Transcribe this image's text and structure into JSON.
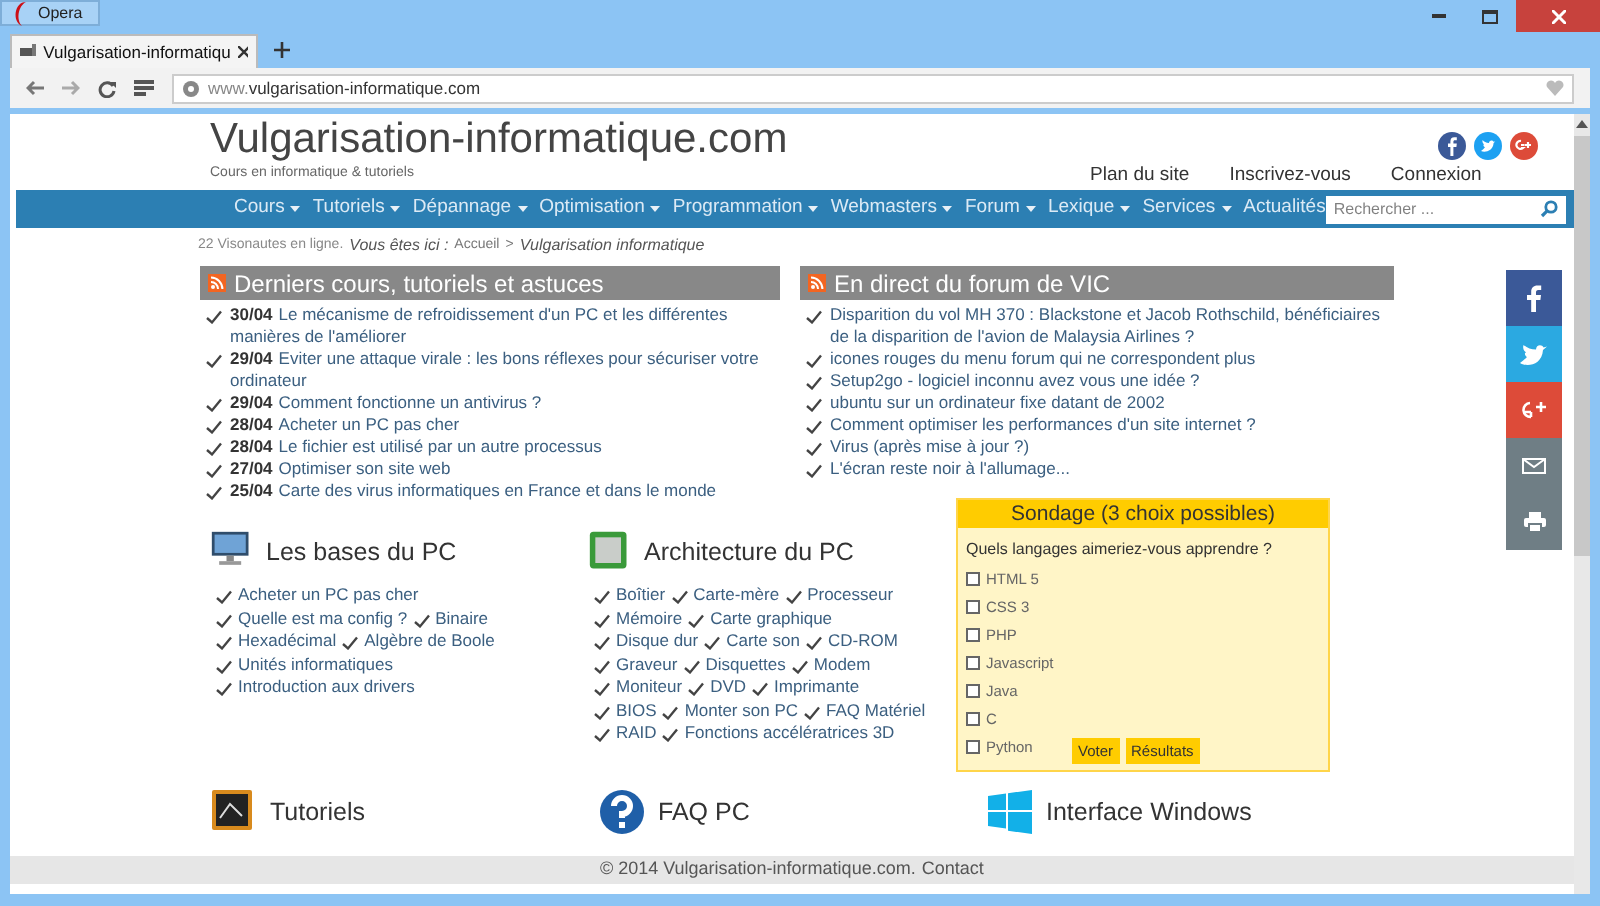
{
  "window": {
    "app_button": "Opera"
  },
  "tab": {
    "title": "Vulgarisation-informatiqu"
  },
  "address_bar": {
    "url_prefix": "www.",
    "url_domain": "vulgarisation-informatique.com"
  },
  "site": {
    "title": "Vulgarisation-informatique.com",
    "tagline": "Cours en informatique & tutoriels"
  },
  "top_links": [
    "Plan du site",
    "Inscrivez-vous",
    "Connexion"
  ],
  "nav": [
    {
      "label": "Cours",
      "dropdown": true
    },
    {
      "label": "Tutoriels",
      "dropdown": true
    },
    {
      "label": "Dépannage",
      "dropdown": true
    },
    {
      "label": "Optimisation",
      "dropdown": true
    },
    {
      "label": "Programmation",
      "dropdown": true
    },
    {
      "label": "Webmasters",
      "dropdown": true
    },
    {
      "label": "Forum",
      "dropdown": true
    },
    {
      "label": "Lexique",
      "dropdown": true
    },
    {
      "label": "Services",
      "dropdown": true
    },
    {
      "label": "Actualités",
      "dropdown": false
    }
  ],
  "search": {
    "placeholder": "Rechercher ..."
  },
  "breadcrumb": {
    "online": "22 Visonautes en ligne.",
    "label": "Vous êtes ici :",
    "home": "Accueil",
    "separator": ">",
    "current": "Vulgarisation informatique"
  },
  "latest": {
    "title": "Derniers cours, tutoriels et astuces",
    "items": [
      {
        "date": "30/04",
        "title": "Le mécanisme de refroidissement d'un PC et les différentes manières de l'améliorer"
      },
      {
        "date": "29/04",
        "title": "Eviter une attaque virale : les bons réflexes pour sécuriser votre ordinateur"
      },
      {
        "date": "29/04",
        "title": "Comment fonctionne un antivirus ?"
      },
      {
        "date": "28/04",
        "title": "Acheter un PC pas cher"
      },
      {
        "date": "28/04",
        "title": "Le fichier est utilisé par un autre processus"
      },
      {
        "date": "27/04",
        "title": "Optimiser son site web"
      },
      {
        "date": "25/04",
        "title": "Carte des virus informatiques en France et dans le monde"
      }
    ]
  },
  "forum": {
    "title": "En direct du forum de VIC",
    "items": [
      "Disparition du vol MH 370 : Blackstone et Jacob Rothschild, bénéficiaires de la disparition de l'avion de Malaysia Airlines ?",
      "icones rouges du menu forum qui ne correspondent plus",
      "Setup2go - logiciel inconnu avez vous une idée ?",
      "ubuntu sur un ordinateur fixe datant de 2002",
      "Comment optimiser les performances d'un site internet ?",
      "Virus (après mise à jour ?)",
      "L'écran reste noir à l'allumage..."
    ]
  },
  "sections": [
    {
      "title": "Les bases du PC",
      "kind": "monitor",
      "rows": [
        [
          "Acheter un PC pas cher"
        ],
        [
          "Quelle est ma config ?",
          "Binaire"
        ],
        [
          "Hexadécimal",
          "Algèbre de Boole"
        ],
        [
          "Unités informatiques"
        ],
        [
          "Introduction aux drivers"
        ]
      ]
    },
    {
      "title": "Architecture du PC",
      "kind": "chip",
      "rows": [
        [
          "Boîtier",
          "Carte-mère",
          "Processeur"
        ],
        [
          "Mémoire",
          "Carte graphique"
        ],
        [
          "Disque dur",
          "Carte son",
          "CD-ROM"
        ],
        [
          "Graveur",
          "Disquettes",
          "Modem"
        ],
        [
          "Moniteur",
          "DVD",
          "Imprimante"
        ],
        [
          "BIOS",
          "Monter son PC",
          "FAQ Matériel"
        ],
        [
          "RAID",
          "Fonctions accélératrices 3D"
        ]
      ]
    }
  ],
  "poll": {
    "title": "Sondage (3 choix possibles)",
    "question": "Quels langages aimeriez-vous apprendre ?",
    "options": [
      {
        "label": "HTML 5",
        "checked": false
      },
      {
        "label": "CSS 3",
        "checked": false
      },
      {
        "label": "PHP",
        "checked": false
      },
      {
        "label": "Javascript",
        "checked": false
      },
      {
        "label": "Java",
        "checked": false
      },
      {
        "label": "C",
        "checked": false
      },
      {
        "label": "Python",
        "checked": false
      }
    ],
    "buttons": [
      "Voter",
      "Résultats"
    ]
  },
  "bottom_sections": [
    {
      "title": "Tutoriels",
      "kind": "board"
    },
    {
      "title": "FAQ PC",
      "kind": "question"
    },
    {
      "title": "Interface Windows",
      "kind": "windows"
    }
  ],
  "footer": {
    "text": "© 2014 Vulgarisation-informatique.com.",
    "link": "Contact"
  }
}
